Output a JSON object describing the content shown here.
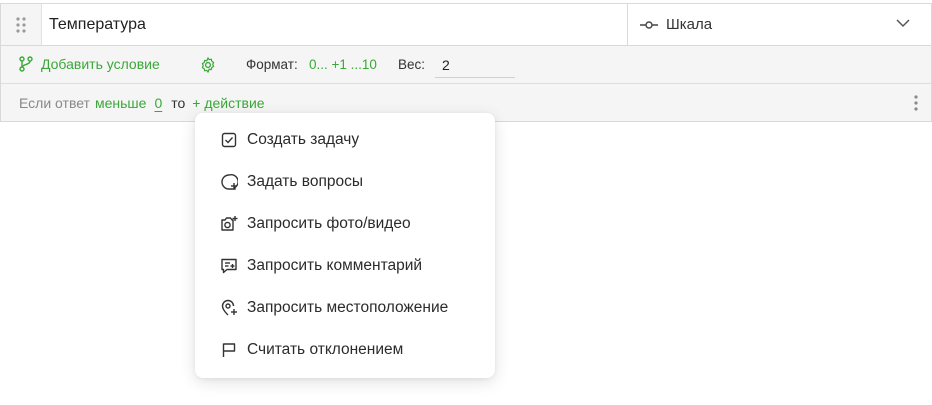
{
  "question": {
    "title": "Температура",
    "type_label": "Шкала"
  },
  "toolbar": {
    "add_condition": "Добавить условие",
    "format_label": "Формат:",
    "format_value": "0... +1 ...10",
    "weight_label": "Вес:",
    "weight_value": "2"
  },
  "condition": {
    "prefix": "Если ответ",
    "operator": "меньше",
    "value": "0",
    "then": "то",
    "action_link": "+ действие"
  },
  "menu": {
    "items": [
      {
        "label": "Создать задачу",
        "icon": "checkbox-icon"
      },
      {
        "label": "Задать вопросы",
        "icon": "chat-plus-icon"
      },
      {
        "label": "Запросить фото/видео",
        "icon": "camera-plus-icon"
      },
      {
        "label": "Запросить комментарий",
        "icon": "comment-plus-icon"
      },
      {
        "label": "Запросить местоположение",
        "icon": "location-plus-icon"
      },
      {
        "label": "Считать отклонением",
        "icon": "flag-icon"
      }
    ]
  },
  "colors": {
    "accent": "#3aa839",
    "border": "#d9d9d9",
    "panel": "#f5f5f5"
  }
}
